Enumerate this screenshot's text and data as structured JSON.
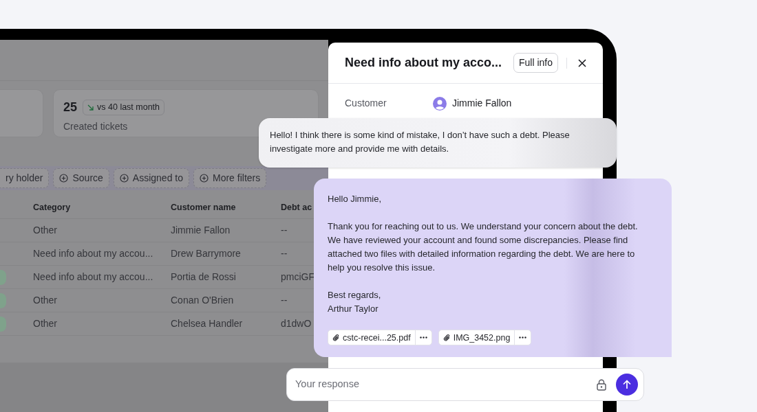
{
  "stats": [
    {
      "kind": "partial"
    },
    {
      "kind": "full",
      "value": "25",
      "comparison": "vs 40 last month",
      "caption": "Created tickets"
    }
  ],
  "filters": [
    {
      "label": "ry holder",
      "cut": true
    },
    {
      "label": "Source",
      "cut": false
    },
    {
      "label": "Assigned to",
      "cut": false
    },
    {
      "label": "More filters",
      "cut": false
    }
  ],
  "table": {
    "columns": [
      "Category",
      "Customer name",
      "Debt ac"
    ],
    "rows": [
      {
        "badge": false,
        "cells": [
          "Other",
          "Jimmie Fallon",
          "--"
        ]
      },
      {
        "badge": false,
        "cells": [
          "Need info about my accou...",
          "Drew Barrymore",
          "--"
        ]
      },
      {
        "badge": true,
        "cells": [
          "Need info about my accou...",
          "Portia de Rossi",
          "pmciGF"
        ]
      },
      {
        "badge": true,
        "cells": [
          "Other",
          "Conan O'Brien",
          "--"
        ]
      },
      {
        "badge": true,
        "cells": [
          "Other",
          "Chelsea Handler",
          "d1dwO"
        ]
      }
    ]
  },
  "panel": {
    "title": "Need info about my acco...",
    "full_info_button": "Full info",
    "customer_label": "Customer",
    "customer_name": "Jimmie Fallon"
  },
  "customer_message": "Hello! I think there is some kind of mistake, I don’t have such a debt. Please investigate more and provide me with details.",
  "agent_message": {
    "paragraphs": [
      "Hello Jimmie,",
      "Thank you for reaching out to us. We understand your concern about the debt. We have reviewed your account and found some discrepancies. Please find attached two files with detailed information regarding the debt. We are here to help you resolve this issue.",
      "Best regards,\nArthur Taylor"
    ],
    "attachments": [
      "cstc-recei...25.pdf",
      "IMG_3452.png"
    ]
  },
  "response": {
    "placeholder": "Your response"
  }
}
